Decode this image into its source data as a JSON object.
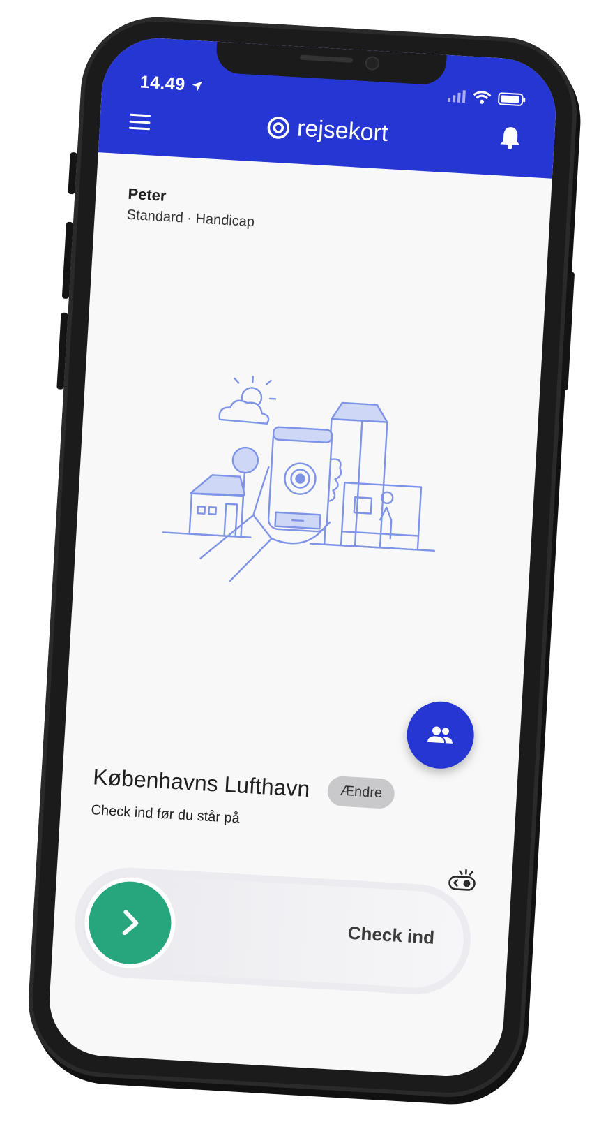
{
  "status_bar": {
    "time": "14.49"
  },
  "header": {
    "brand": "rejsekort",
    "icons": [
      "menu-icon",
      "rejsekort-logo-icon",
      "bell-icon",
      "location-arrow-icon",
      "signal-icon",
      "wifi-icon",
      "battery-icon"
    ]
  },
  "profile": {
    "name": "Peter",
    "subtitle": "Standard · Handicap"
  },
  "station": {
    "name": "Københavns Lufthavn",
    "change_label": "Ændre",
    "hint": "Check ind før du står på"
  },
  "checkin": {
    "label": "Check ind"
  },
  "colors": {
    "brand_blue": "#2636d2",
    "checkin_green": "#27a67e",
    "illustration_blue": "#7f94e6"
  }
}
